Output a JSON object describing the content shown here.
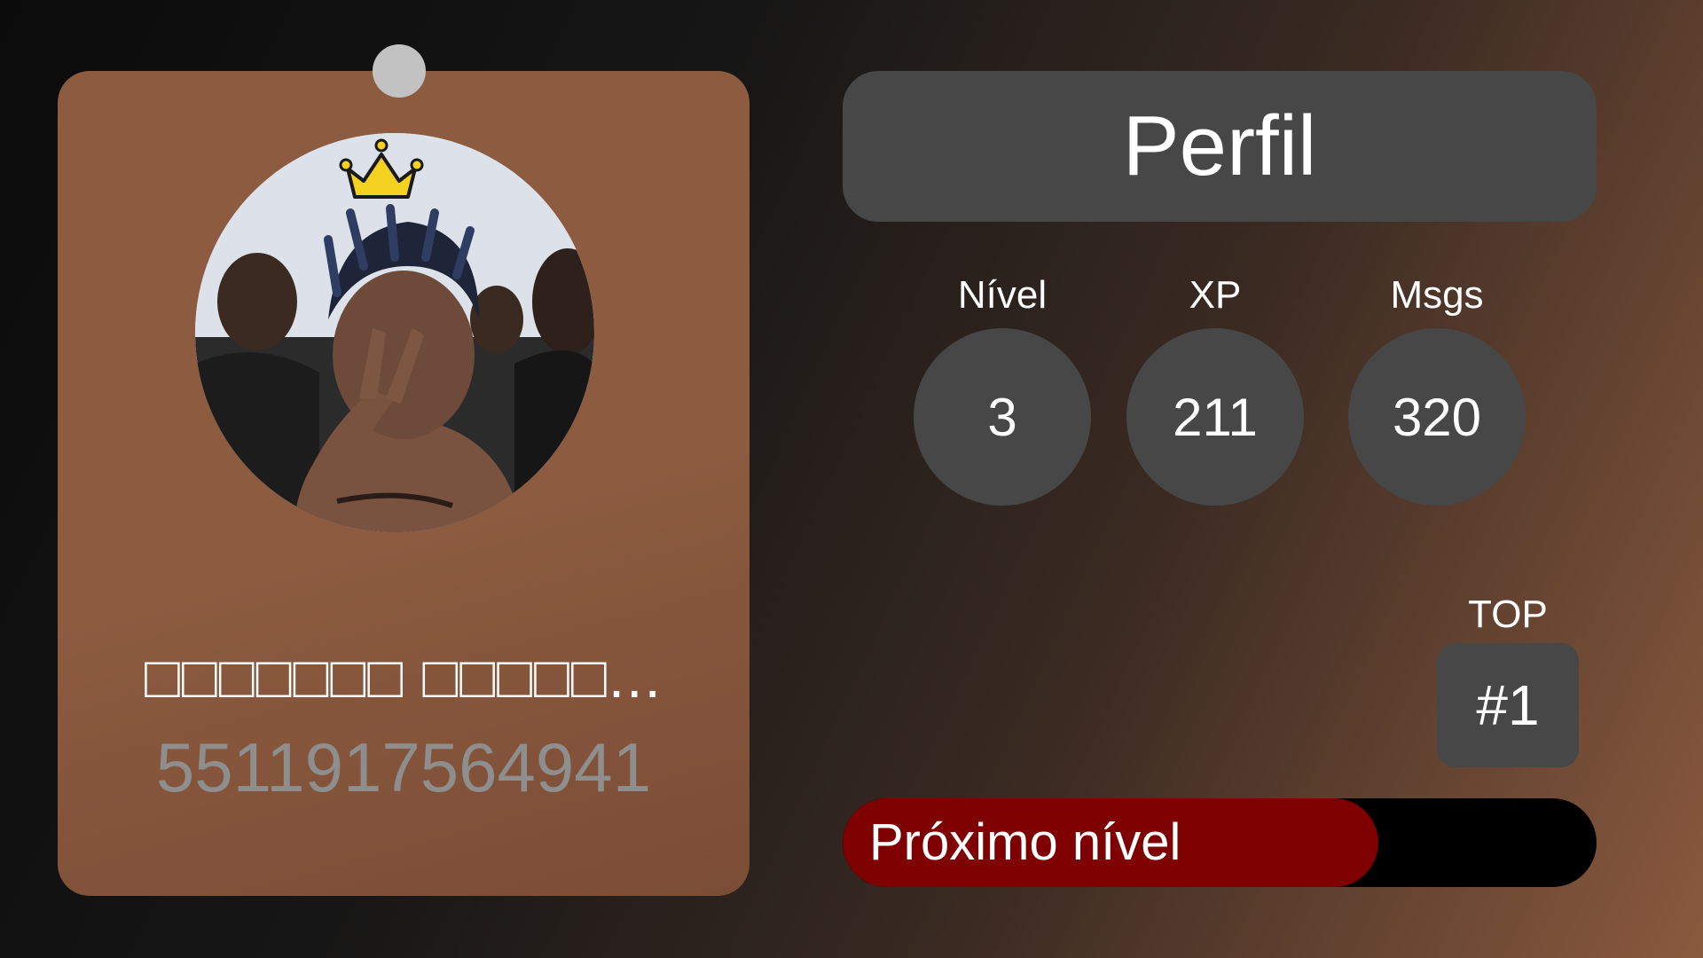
{
  "profile_card": {
    "avatar_icon": "user-photo",
    "crown_icon": "crown-icon",
    "username": "□□□□□□□ □□□□□...",
    "phone": "5511917564941"
  },
  "header": {
    "title": "Perfil"
  },
  "stats": {
    "level_label": "Nível",
    "level_value": "3",
    "xp_label": "XP",
    "xp_value": "211",
    "msgs_label": "Msgs",
    "msgs_value": "320"
  },
  "rank": {
    "label": "TOP",
    "value": "#1"
  },
  "progress": {
    "label": "Próximo nível",
    "fraction": 0.71
  },
  "colors": {
    "card": "#8c5b40",
    "panel": "#474747",
    "progress_fill": "#7e0000",
    "progress_track": "#000000",
    "pin": "#c2c2c2",
    "crown": "#f5d21f"
  }
}
